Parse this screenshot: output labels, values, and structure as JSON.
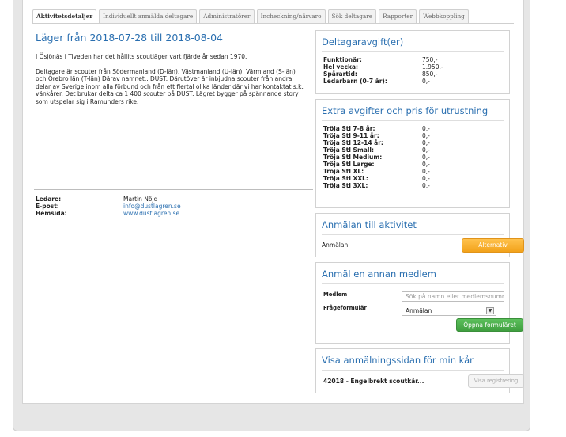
{
  "tabs": [
    {
      "label": "Aktivitetsdetaljer",
      "active": true
    },
    {
      "label": "Individuellt anmälda deltagare"
    },
    {
      "label": "Administratörer"
    },
    {
      "label": "Incheckning/närvaro"
    },
    {
      "label": "Sök deltagare"
    },
    {
      "label": "Rapporter"
    },
    {
      "label": "Webbkoppling"
    }
  ],
  "activity": {
    "title": "Läger från 2018-07-28 till 2018-08-04",
    "paragraphs": [
      "I Ösjönäs i Tiveden har det hållits scoutläger vart fjärde år sedan 1970.",
      "Deltagare är scouter från Södermanland (D-län), Västmanland (U-län), Värmland (S-län) och Örebro län (T-län) Därav namnet.. DUST. Därutöver är inbjudna scouter från andra delar av Sverige inom alla förbund och från ett flertal olika länder där vi har kontaktat s.k. vänkårer. Det brukar delta ca 1 400 scouter på DUST. Lägret bygger på spännande story som utspelar sig i Ramunders rike."
    ]
  },
  "contact": {
    "leader_label": "Ledare:",
    "leader": "Martin Nöjd",
    "email_label": "E-post:",
    "email": "info@dustlagren.se",
    "web_label": "Hemsida:",
    "web": "www.dustlagren.se"
  },
  "fees": {
    "title": "Deltagaravgift(er)",
    "rows": [
      {
        "label": "Funktionär:",
        "value": "750,-"
      },
      {
        "label": "Hel vecka:",
        "value": "1.950,-"
      },
      {
        "label": "Spårartid:",
        "value": "850,-"
      },
      {
        "label": "Ledarbarn (0-7 år):",
        "value": "0,-"
      }
    ]
  },
  "extras": {
    "title": "Extra avgifter och pris för utrustning",
    "rows": [
      {
        "label": "Tröja Stl 7-8 år:",
        "value": "0,-"
      },
      {
        "label": "Tröja Stl 9-11 år:",
        "value": "0,-"
      },
      {
        "label": "Tröja Stl 12-14 år:",
        "value": "0,-"
      },
      {
        "label": "Tröja Stl Small:",
        "value": "0,-"
      },
      {
        "label": "Tröja Stl Medium:",
        "value": "0,-"
      },
      {
        "label": "Tröja Stl Large:",
        "value": "0,-"
      },
      {
        "label": "Tröja Stl XL:",
        "value": "0,-"
      },
      {
        "label": "Tröja Stl XXL:",
        "value": "0,-"
      },
      {
        "label": "Tröja Stl 3XL:",
        "value": "0,-"
      }
    ]
  },
  "signup": {
    "title": "Anmälan till aktivitet",
    "label": "Anmälan",
    "button": "Alternativ"
  },
  "other_member": {
    "title": "Anmäl en annan medlem",
    "member_label": "Medlem",
    "member_placeholder": "Sök på namn eller medlemsnummer",
    "form_label": "Frågeformulär",
    "form_value": "Anmälan",
    "button": "Öppna formuläret"
  },
  "signup_page": {
    "title": "Visa anmälningssidan för min kår",
    "unit": "42018 - Engelbrekt scoutkår...",
    "button": "Visa registrering"
  }
}
